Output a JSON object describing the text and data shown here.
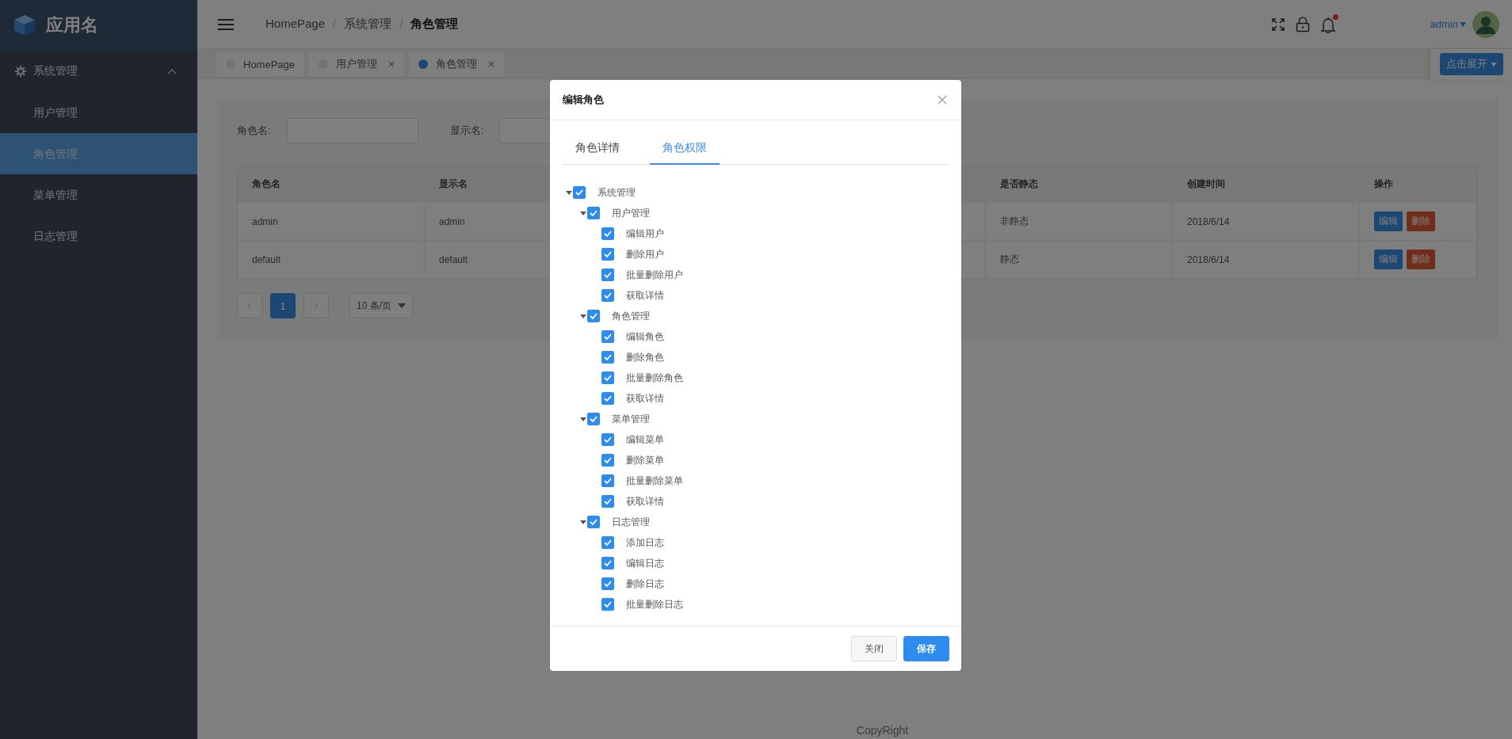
{
  "app": {
    "name": "应用名"
  },
  "sidebar": {
    "items": [
      {
        "label": "系统管理",
        "expanded": true,
        "children": [
          {
            "label": "用户管理",
            "selected": false
          },
          {
            "label": "角色管理",
            "selected": true
          },
          {
            "label": "菜单管理",
            "selected": false
          },
          {
            "label": "日志管理",
            "selected": false
          }
        ]
      }
    ]
  },
  "breadcrumb": {
    "separator": "/",
    "items": [
      "HomePage",
      "系统管理",
      "角色管理"
    ]
  },
  "header": {
    "user": "admin",
    "notification": true
  },
  "page_tabs": [
    {
      "label": "HomePage",
      "selected": false,
      "closable": false
    },
    {
      "label": "用户管理",
      "selected": false,
      "closable": true
    },
    {
      "label": "角色管理",
      "selected": true,
      "closable": true
    }
  ],
  "expand_button": "点击展开",
  "search": [
    {
      "label": "角色名:"
    },
    {
      "label": "显示名:"
    }
  ],
  "table": {
    "columns": [
      "角色名",
      "显示名",
      "是否静态",
      "创建时间",
      "操作"
    ],
    "rows": [
      {
        "cells": [
          "admin",
          "admin",
          "非静态",
          "2018/6/14"
        ],
        "actions": [
          "编辑",
          "删除"
        ]
      },
      {
        "cells": [
          "default",
          "default",
          "静态",
          "2018/6/14"
        ],
        "actions": [
          "编辑",
          "删除"
        ]
      }
    ]
  },
  "pager": {
    "page": "1",
    "page_size": "10 条/页"
  },
  "footer": "CopyRight",
  "dialog": {
    "title": "编辑角色",
    "tabs": [
      {
        "label": "角色详情",
        "selected": false
      },
      {
        "label": "角色权限",
        "selected": true
      }
    ],
    "tree": [
      {
        "label": "系统管理",
        "checked": true,
        "expanded": true,
        "children": [
          {
            "label": "用户管理",
            "checked": true,
            "expanded": true,
            "children": [
              {
                "label": "编辑用户",
                "checked": true
              },
              {
                "label": "删除用户",
                "checked": true
              },
              {
                "label": "批量删除用户",
                "checked": true
              },
              {
                "label": "获取详情",
                "checked": true
              }
            ]
          },
          {
            "label": "角色管理",
            "checked": true,
            "expanded": true,
            "children": [
              {
                "label": "编辑角色",
                "checked": true
              },
              {
                "label": "删除角色",
                "checked": true
              },
              {
                "label": "批量删除角色",
                "checked": true
              },
              {
                "label": "获取详情",
                "checked": true
              }
            ]
          },
          {
            "label": "菜单管理",
            "checked": true,
            "expanded": true,
            "children": [
              {
                "label": "编辑菜单",
                "checked": true
              },
              {
                "label": "删除菜单",
                "checked": true
              },
              {
                "label": "批量删除菜单",
                "checked": true
              },
              {
                "label": "获取详情",
                "checked": true
              }
            ]
          },
          {
            "label": "日志管理",
            "checked": true,
            "expanded": true,
            "children": [
              {
                "label": "添加日志",
                "checked": true
              },
              {
                "label": "编辑日志",
                "checked": true
              },
              {
                "label": "删除日志",
                "checked": true
              },
              {
                "label": "批量删除日志",
                "checked": true
              }
            ]
          }
        ]
      }
    ],
    "buttons": [
      {
        "label": "关闭",
        "kind": "default"
      },
      {
        "label": "保存",
        "kind": "primary"
      }
    ]
  }
}
